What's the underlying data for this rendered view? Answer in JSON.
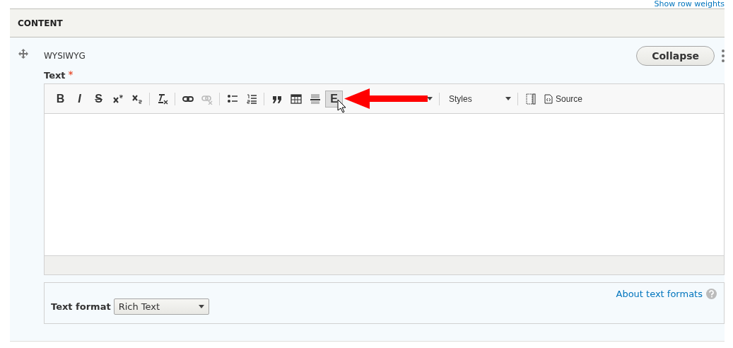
{
  "top_link": "Show row weights",
  "section": {
    "title": "CONTENT"
  },
  "paragraph": {
    "type_label": "WYSIWYG",
    "collapse_button": "Collapse"
  },
  "field": {
    "label": "Text",
    "required_mark": "*"
  },
  "toolbar": [
    {
      "kind": "glyph",
      "label": "B",
      "selected": false
    },
    {
      "kind": "glyph",
      "label": "I",
      "selected": false
    },
    {
      "kind": "glyph",
      "label": "S",
      "selected": false
    },
    {
      "kind": "icon",
      "selected": false
    },
    {
      "kind": "icon",
      "selected": false
    },
    {
      "kind": "separator"
    },
    {
      "kind": "icon",
      "selected": false
    },
    {
      "kind": "separator"
    },
    {
      "kind": "icon",
      "selected": false
    },
    {
      "kind": "icon",
      "selected": false
    },
    {
      "kind": "separator"
    },
    {
      "kind": "icon",
      "selected": false
    },
    {
      "kind": "icon",
      "selected": false
    },
    {
      "kind": "separator"
    },
    {
      "kind": "icon",
      "selected": false
    },
    {
      "kind": "icon",
      "selected": false
    },
    {
      "kind": "icon",
      "selected": false
    },
    {
      "kind": "glyph",
      "label": "E",
      "selected": true
    },
    {
      "kind": "dropdown"
    },
    {
      "kind": "separator"
    },
    {
      "kind": "dropdown",
      "label": "Styles"
    },
    {
      "kind": "separator"
    },
    {
      "kind": "icon",
      "selected": false
    },
    {
      "kind": "source",
      "label": "Source",
      "selected": false
    }
  ],
  "text_format": {
    "label": "Text format",
    "value": "Rich Text",
    "help_link": "About text formats"
  }
}
